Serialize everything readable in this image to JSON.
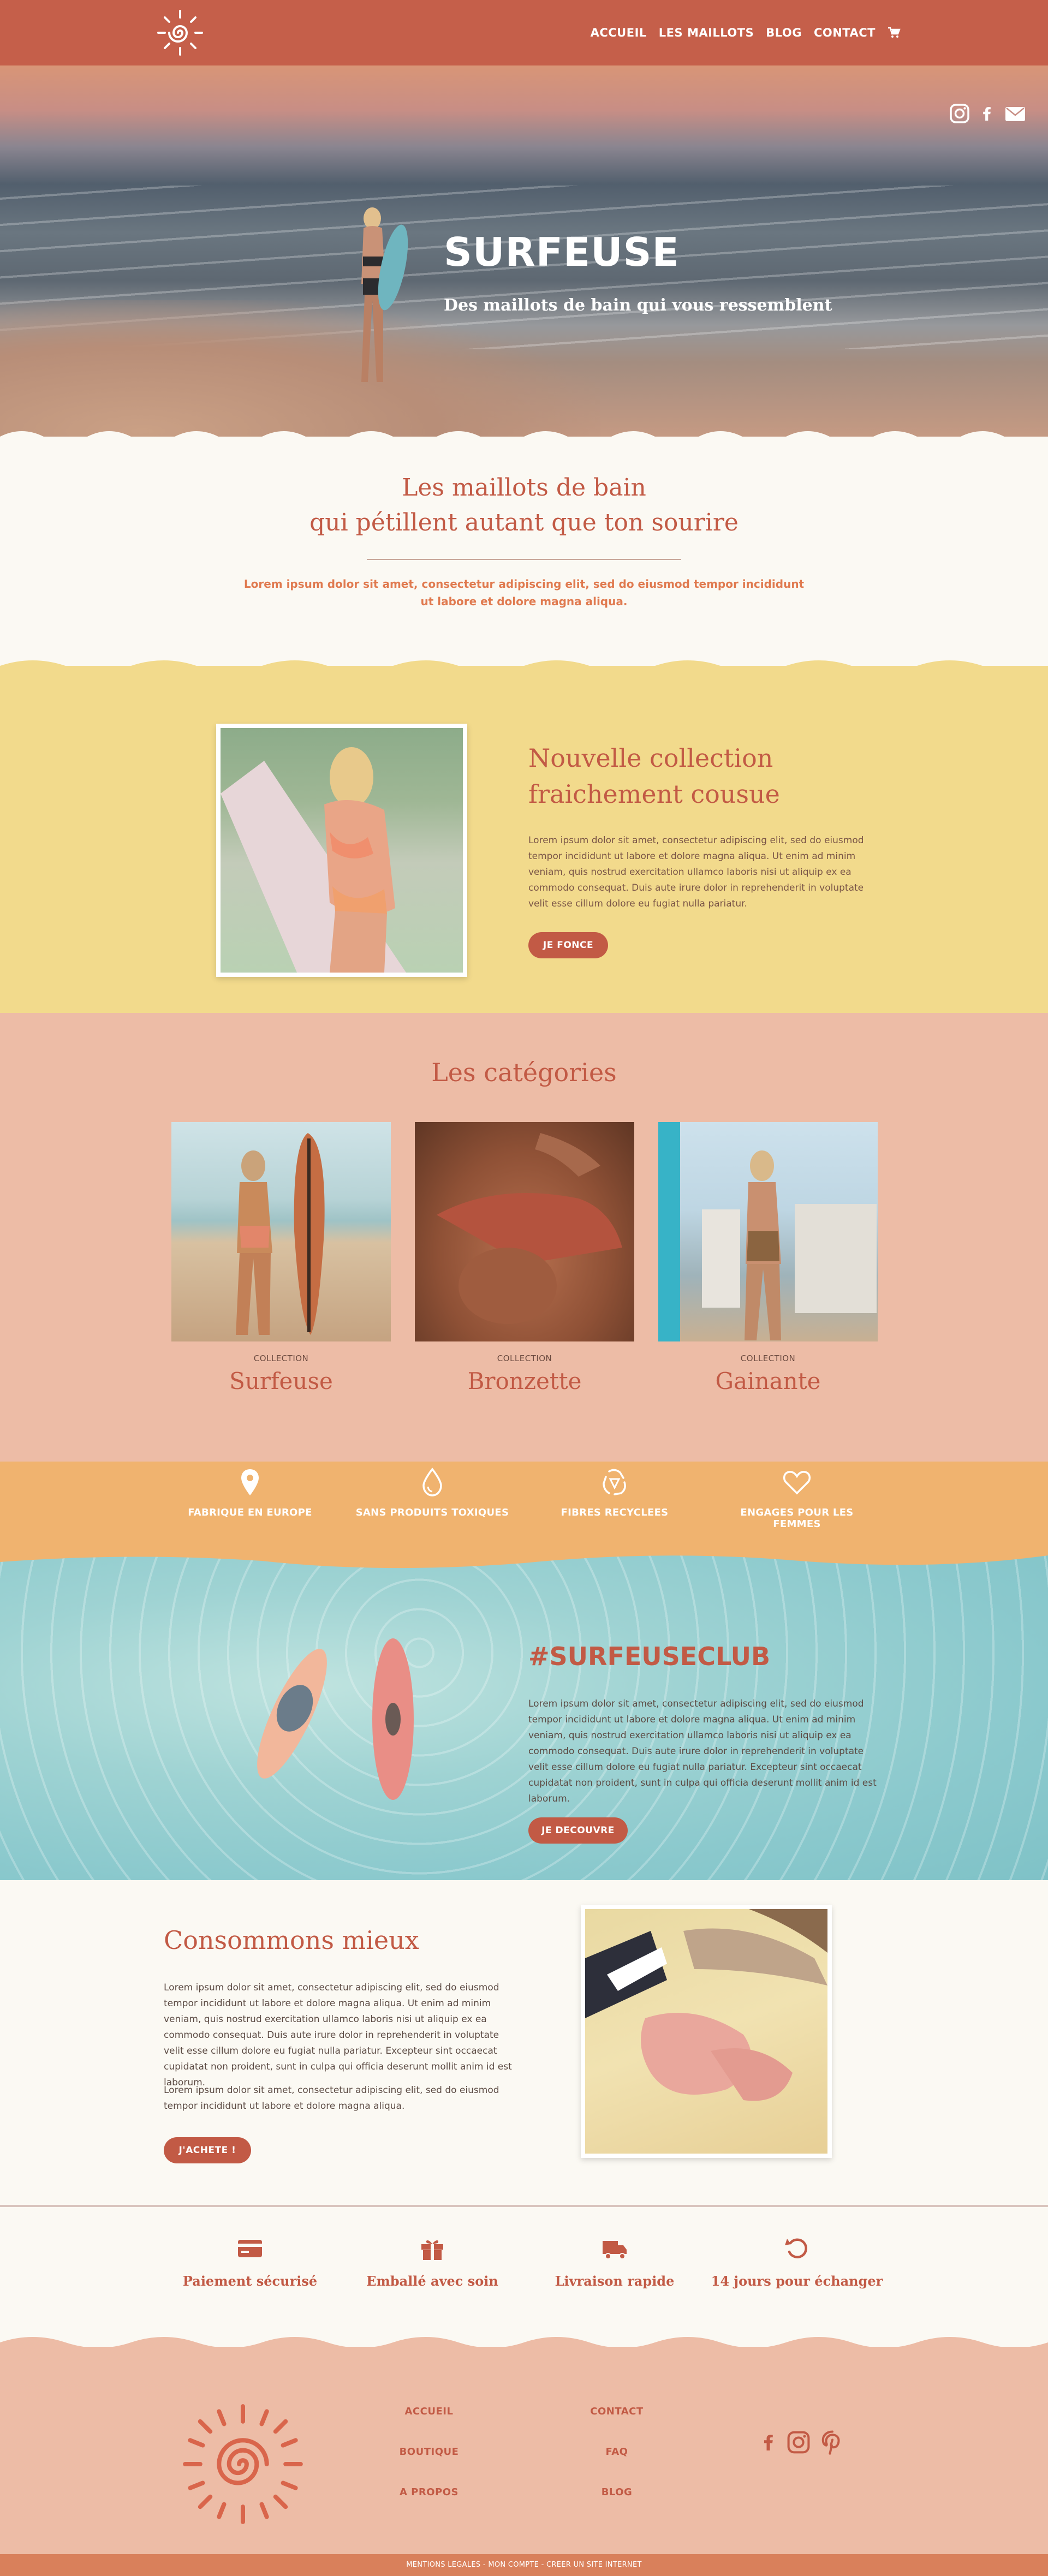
{
  "header": {
    "nav": [
      "ACCUEIL",
      "LES MAILLOTS",
      "BLOG",
      "CONTACT"
    ]
  },
  "hero": {
    "title": "SURFEUSE",
    "subtitle": "Des maillots de bain qui vous ressemblent"
  },
  "intro": {
    "title_line1": "Les maillots de bain",
    "title_line2": "qui pétillent autant que ton sourire",
    "text_line1": "Lorem ipsum dolor sit amet, consectetur adipiscing elit, sed do eiusmod tempor incididunt",
    "text_line2": "ut labore et dolore magna aliqua."
  },
  "collection": {
    "title_line1": "Nouvelle collection",
    "title_line2": "fraichement cousue",
    "text": "Lorem ipsum dolor sit amet, consectetur adipiscing elit, sed do eiusmod tempor incididunt ut labore et dolore magna aliqua. Ut enim ad minim veniam, quis nostrud exercitation ullamco laboris nisi ut aliquip ex ea commodo consequat. Duis aute irure dolor in reprehenderit in voluptate velit esse cillum dolore eu fugiat nulla pariatur.",
    "button": "JE FONCE"
  },
  "categories": {
    "title": "Les catégories",
    "kicker": "COLLECTION",
    "items": [
      "Surfeuse",
      "Bronzette",
      "Gainante"
    ]
  },
  "features": [
    "FABRIQUE EN EUROPE",
    "SANS PRODUITS TOXIQUES",
    "FIBRES RECYCLEES",
    "ENGAGES POUR LES FEMMES"
  ],
  "club": {
    "title": "#SURFEUSECLUB",
    "text": "Lorem ipsum dolor sit amet, consectetur adipiscing elit, sed do eiusmod tempor incididunt ut labore et dolore magna aliqua. Ut enim ad minim veniam, quis nostrud exercitation ullamco laboris nisi ut aliquip ex ea commodo consequat. Duis aute irure dolor in reprehenderit in voluptate velit esse cillum dolore eu fugiat nulla pariatur. Excepteur sint occaecat cupidatat non proident, sunt in culpa qui officia deserunt mollit anim id est laborum.",
    "button": "JE DECOUVRE"
  },
  "consume": {
    "title": "Consommons mieux",
    "text1": "Lorem ipsum dolor sit amet, consectetur adipiscing elit, sed do eiusmod tempor incididunt ut labore et dolore magna aliqua. Ut enim ad minim veniam, quis nostrud exercitation ullamco laboris nisi ut aliquip ex ea commodo consequat. Duis aute irure dolor in reprehenderit in voluptate velit esse cillum dolore eu fugiat nulla pariatur. Excepteur sint occaecat cupidatat non proident, sunt in culpa qui officia deserunt mollit anim id est laborum.",
    "text2": "Lorem ipsum dolor sit amet, consectetur adipiscing elit, sed do eiusmod tempor incididunt ut labore et dolore magna aliqua.",
    "button": "J'ACHETE !"
  },
  "services": [
    "Paiement sécurisé",
    "Emballé avec soin",
    "Livraison rapide",
    "14 jours pour échanger"
  ],
  "footer": {
    "col1": [
      "ACCUEIL",
      "BOUTIQUE",
      "A PROPOS"
    ],
    "col2": [
      "CONTACT",
      "FAQ",
      "BLOG"
    ],
    "bottom": "MENTIONS LEGALES - MON COMPTE - CREER UN SITE INTERNET"
  },
  "colors": {
    "brand": "#c55f4a",
    "yellow": "#f2da8c",
    "pink": "#edbca6",
    "orange": "#f0b36f",
    "cream": "#fbf9f3"
  },
  "icons": {
    "social_header": [
      "instagram-icon",
      "facebook-icon",
      "envelope-icon"
    ],
    "features": [
      "map-pin-icon",
      "drop-icon",
      "recycle-icon",
      "heart-icon"
    ],
    "services": [
      "credit-card-icon",
      "gift-icon",
      "truck-icon",
      "undo-icon"
    ],
    "social_footer": [
      "facebook-icon",
      "instagram-icon",
      "pinterest-icon"
    ]
  }
}
